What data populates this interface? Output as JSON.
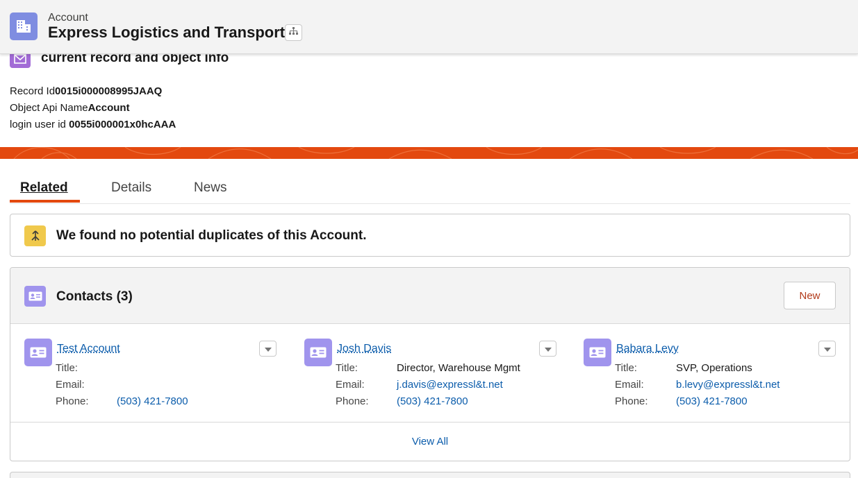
{
  "header": {
    "object_type": "Account",
    "record_name": "Express Logistics and Transport",
    "icon": "building-icon",
    "hierarchy_icon": "hierarchy-icon"
  },
  "info_card": {
    "title": "current record and object info",
    "icon": "email-icon",
    "record_id_label": "Record Id",
    "record_id_value": "0015i000008995JAAQ",
    "object_api_label": "Object Api Name",
    "object_api_value": "Account",
    "login_user_label": "login user id ",
    "login_user_value": "0055i000001x0hcAAA"
  },
  "colors": {
    "banner": "#e3490f",
    "link": "#0b5cab",
    "account_icon": "#7f8de1",
    "contact_icon": "#a094ed"
  },
  "tabs": [
    {
      "label": "Related",
      "active": true
    },
    {
      "label": "Details",
      "active": false
    },
    {
      "label": "News",
      "active": false
    }
  ],
  "duplicates": {
    "icon": "merge-icon",
    "message": "We found no potential duplicates of this Account."
  },
  "contacts": {
    "title": "Contacts (3)",
    "new_label": "New",
    "view_all_label": "View All",
    "field_labels": {
      "title": "Title:",
      "email": "Email:",
      "phone": "Phone:"
    },
    "items": [
      {
        "name": "Test Account",
        "title": "",
        "email": "",
        "phone": "(503) 421-7800"
      },
      {
        "name": "Josh Davis",
        "title": "Director, Warehouse Mgmt",
        "email": "j.davis@expressl&t.net",
        "phone": "(503) 421-7800"
      },
      {
        "name": "Babara Levy",
        "title": "SVP, Operations",
        "email": "b.levy@expressl&t.net",
        "phone": "(503) 421-7800"
      }
    ]
  }
}
